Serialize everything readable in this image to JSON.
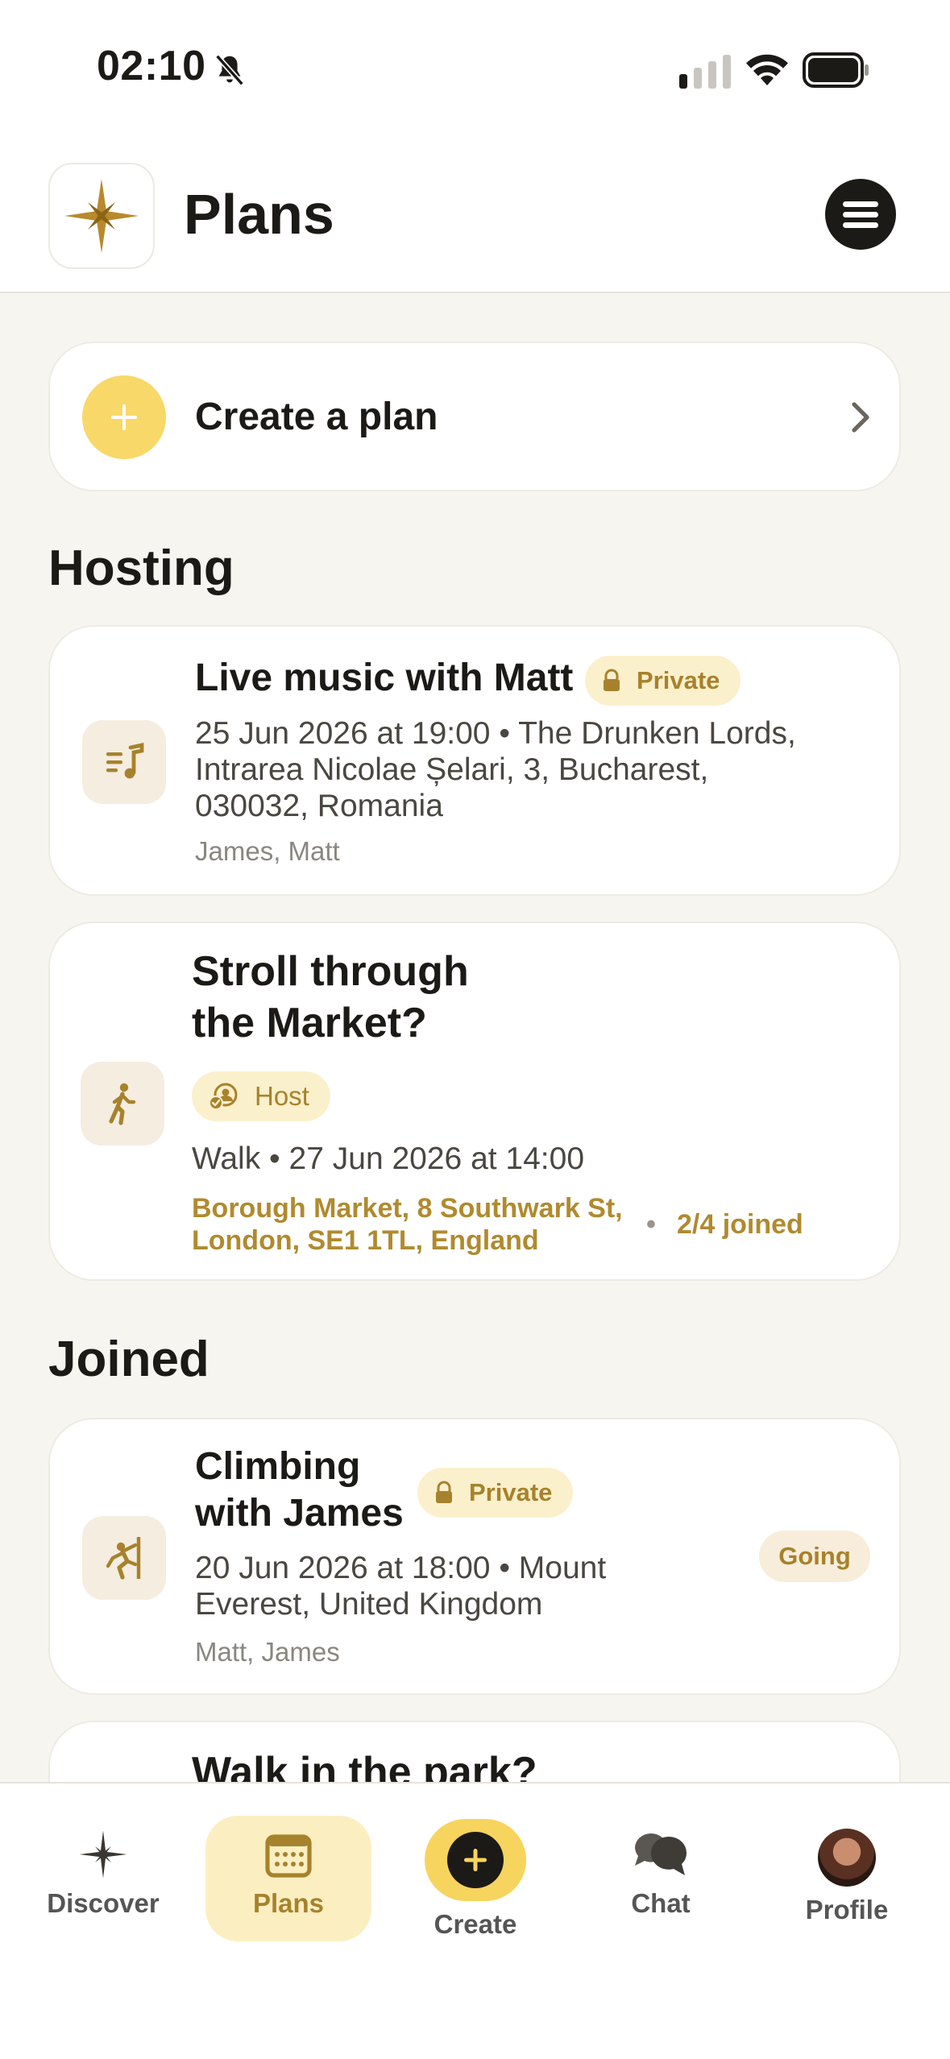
{
  "status_bar": {
    "time": "02:10"
  },
  "header": {
    "title": "Plans"
  },
  "create_plan": {
    "label": "Create a plan"
  },
  "sections": {
    "hosting": "Hosting",
    "joined": "Joined"
  },
  "hosting": [
    {
      "title": "Live music with Matt",
      "badge": "Private",
      "meta_lines": [
        "25 Jun 2026 at 19:00 • The Drunken Lords,",
        "Intrarea Nicolae Șelari, 3, Bucharest,",
        "030032, Romania"
      ],
      "people": "James, Matt",
      "icon": "music-icon"
    },
    {
      "title_lines": [
        "Stroll through",
        "the Market?"
      ],
      "badge": "Host",
      "meta": "Walk • 27 Jun 2026 at 14:00",
      "location_lines": [
        "Borough Market, 8 Southwark St,",
        "London, SE1 1TL, England"
      ],
      "joined": "2/4 joined",
      "icon": "walk-icon"
    }
  ],
  "joined": [
    {
      "title_lines": [
        "Climbing",
        "with James"
      ],
      "badge": "Private",
      "meta_lines": [
        "20 Jun 2026 at 18:00 • Mount",
        "Everest, United Kingdom"
      ],
      "people": "Matt, James",
      "status": "Going",
      "icon": "climbing-icon"
    },
    {
      "title": "Walk in the park?"
    }
  ],
  "nav": {
    "discover": "Discover",
    "plans": "Plans",
    "create": "Create",
    "chat": "Chat",
    "profile": "Profile"
  },
  "colors": {
    "accent": "#f8d868",
    "gold": "#b08a2e",
    "background": "#f7f5f0"
  }
}
